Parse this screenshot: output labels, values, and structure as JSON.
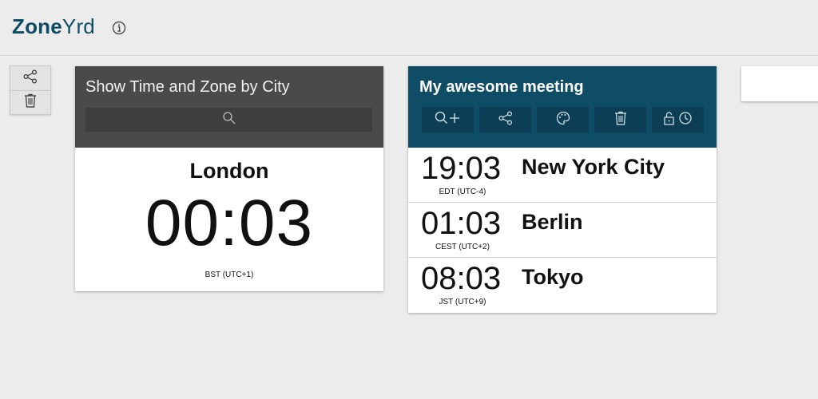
{
  "app": {
    "logo_bold": "Zone",
    "logo_light": "Yrd",
    "info_icon": "info-icon"
  },
  "side_toolbar": {
    "icons": [
      "share-icon",
      "trash-icon"
    ]
  },
  "city_search": {
    "title": "Show Time and Zone by City",
    "search_placeholder": "",
    "clock": {
      "city": "London",
      "time": "00:03",
      "zone": "BST (UTC+1)"
    }
  },
  "meeting": {
    "title": "My awesome meeting",
    "toolbar_icons": [
      "search-add-icon",
      "share-icon",
      "palette-icon",
      "trash-icon",
      "lock-clock-icon"
    ],
    "rows": [
      {
        "time": "19:03",
        "zone": "EDT (UTC-4)",
        "city": "New York City"
      },
      {
        "time": "01:03",
        "zone": "CEST (UTC+2)",
        "city": "Berlin"
      },
      {
        "time": "08:03",
        "zone": "JST (UTC+9)",
        "city": "Tokyo"
      }
    ]
  },
  "colors": {
    "brand": "#0f4c65",
    "dark_panel": "#4a4a4a",
    "background": "#ececec"
  }
}
